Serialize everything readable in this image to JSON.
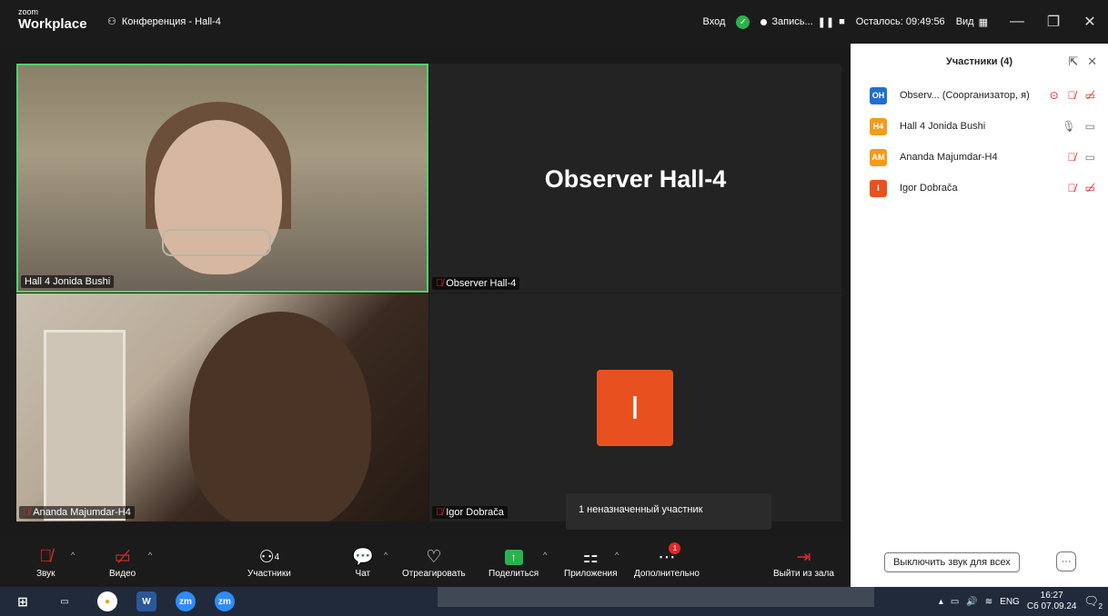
{
  "titlebar": {
    "logo_small": "zoom",
    "logo_big": "Workplace",
    "conference_title": "Конференция - Hall-4",
    "login_label": "Вход",
    "recording_label": "Запись...",
    "time_left": "Осталось: 09:49:56",
    "view_label": "Вид"
  },
  "videos": {
    "tile1_name": "Hall 4  Jonida Bushi",
    "tile2_name": "Observer  Hall-4",
    "tile2_center": "Observer  Hall-4",
    "tile3_name": "Ananda Majumdar-H4",
    "tile4_name": "Igor Dobrača",
    "tile4_avatar": "I",
    "tooltip": "1 неназначенный участник"
  },
  "sidebar": {
    "title": "Участники (4)",
    "participants": [
      {
        "initials": "OH",
        "name": "Observ...  (Соорганизатор, я)",
        "color": "#1e6fd0"
      },
      {
        "initials": "H4",
        "name": "Hall 4  Jonida Bushi",
        "color": "#f59b1a"
      },
      {
        "initials": "AM",
        "name": "Ananda Majumdar-H4",
        "color": "#f59b1a"
      },
      {
        "initials": "I",
        "name": "Igor Dobrača",
        "color": "#e8511f"
      }
    ],
    "mute_all_label": "Выключить звук для всех",
    "more_label": "···"
  },
  "toolbar": {
    "audio": "Звук",
    "video": "Видео",
    "participants": "Участники",
    "participants_count": "4",
    "chat": "Чат",
    "react": "Отреагировать",
    "share": "Поделиться",
    "apps": "Приложения",
    "more": "Дополнительно",
    "more_badge": "1",
    "leave": "Выйти из зала"
  },
  "taskbar": {
    "lang": "ENG",
    "time": "16:27",
    "date": "Сб 07.09.24",
    "notif_count": "2",
    "word_label": "W",
    "zoom_label": "zm"
  }
}
